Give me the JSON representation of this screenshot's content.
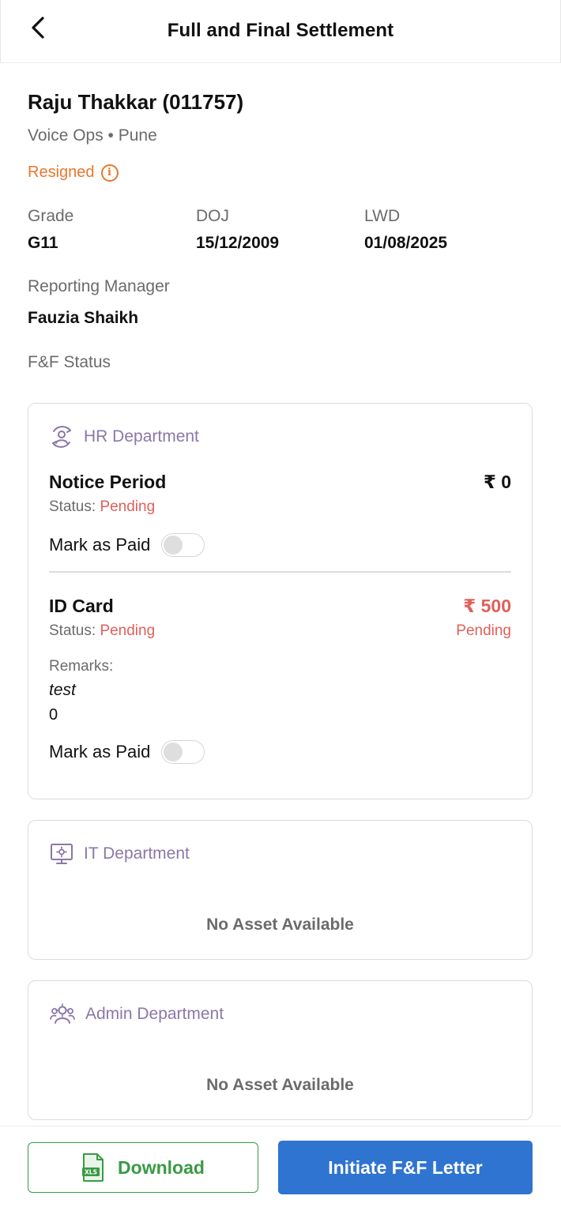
{
  "header": {
    "title": "Full and Final Settlement"
  },
  "employee": {
    "name": "Raju Thakkar (011757)",
    "sub": "Voice Ops • Pune",
    "status": "Resigned",
    "grade_label": "Grade",
    "grade": "G11",
    "doj_label": "DOJ",
    "doj": "15/12/2009",
    "lwd_label": "LWD",
    "lwd": "01/08/2025",
    "manager_label": "Reporting Manager",
    "manager": "Fauzia Shaikh",
    "ff_status_label": "F&F Status"
  },
  "hr": {
    "title": "HR Department",
    "items": [
      {
        "title": "Notice Period",
        "amount": "₹ 0",
        "status_label": "Status:",
        "status": "Pending",
        "mark_label": "Mark as Paid",
        "paid": false
      },
      {
        "title": "ID Card",
        "amount": "₹ 500",
        "status_label": "Status:",
        "status": "Pending",
        "status_right": "Pending",
        "remarks_label": "Remarks:",
        "remarks": "test",
        "remarks_value": "0",
        "mark_label": "Mark as Paid",
        "paid": false
      }
    ]
  },
  "it": {
    "title": "IT Department",
    "empty": "No Asset Available"
  },
  "admin": {
    "title": "Admin Department",
    "empty": "No Asset Available"
  },
  "footer": {
    "download_label": "Download",
    "download_icon_text": "XLS",
    "initiate_label": "Initiate F&F Letter"
  },
  "colors": {
    "accent_blue": "#2f74d0",
    "green": "#3a9a43",
    "pending_red": "#e0605a",
    "resigned_orange": "#e8772e",
    "dept_purple": "#8a78a8"
  },
  "icons": [
    "back-arrow-icon",
    "info-icon",
    "hr-user-icon",
    "monitor-gear-icon",
    "users-gear-icon",
    "xls-file-icon"
  ]
}
